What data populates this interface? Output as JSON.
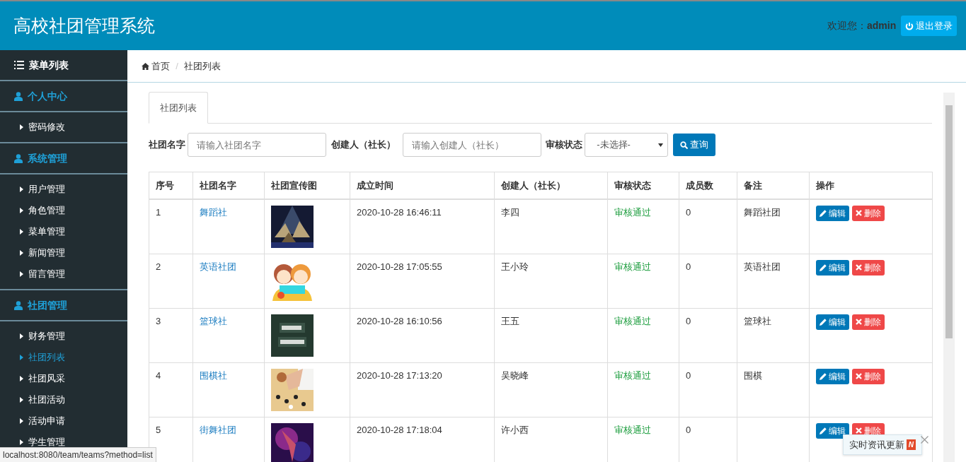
{
  "header": {
    "title": "高校社团管理系统",
    "welcome": "欢迎您：",
    "user": "admin",
    "logout": "退出登录"
  },
  "sidebar": {
    "title": "菜单列表",
    "groups": [
      {
        "label": "个人中心",
        "items": [
          {
            "label": "密码修改",
            "selected": false
          }
        ]
      },
      {
        "label": "系统管理",
        "items": [
          {
            "label": "用户管理",
            "selected": false
          },
          {
            "label": "角色管理",
            "selected": false
          },
          {
            "label": "菜单管理",
            "selected": false
          },
          {
            "label": "新闻管理",
            "selected": false
          },
          {
            "label": "留言管理",
            "selected": false
          }
        ]
      },
      {
        "label": "社团管理",
        "items": [
          {
            "label": "财务管理",
            "selected": false
          },
          {
            "label": "社团列表",
            "selected": true
          },
          {
            "label": "社团风采",
            "selected": false
          },
          {
            "label": "社团活动",
            "selected": false
          },
          {
            "label": "活动申请",
            "selected": false
          },
          {
            "label": "学生管理",
            "selected": false
          }
        ]
      }
    ]
  },
  "breadcrumb": [
    "首页",
    "社团列表"
  ],
  "breadcrumb_separator": "/",
  "tabs": [
    {
      "label": "社团列表",
      "selected": true
    }
  ],
  "filters": {
    "name_label": "社团名字",
    "name_placeholder": "请输入社团名字",
    "creator_label": "创建人（社长）",
    "creator_placeholder": "请输入创建人（社长）",
    "status_label": "审核状态",
    "status_value": "-未选择-",
    "search": "查询"
  },
  "table": {
    "columns": [
      "序号",
      "社团名字",
      "社团宣传图",
      "成立时间",
      "创建人（社长）",
      "审核状态",
      "成员数",
      "备注",
      "操作"
    ],
    "rows": [
      {
        "no": "1",
        "name": "舞蹈社",
        "time": "2020-10-28 16:46:11",
        "creator": "李四",
        "status": "审核通过",
        "members": "0",
        "note": "舞蹈社团",
        "edit": "编辑",
        "delete": "删除"
      },
      {
        "no": "2",
        "name": "英语社团",
        "time": "2020-10-28 17:05:55",
        "creator": "王小玲",
        "status": "审核通过",
        "members": "0",
        "note": "英语社团",
        "edit": "编辑",
        "delete": "删除"
      },
      {
        "no": "3",
        "name": "篮球社",
        "time": "2020-10-28 16:10:56",
        "creator": "王五",
        "status": "审核通过",
        "members": "0",
        "note": "篮球社",
        "edit": "编辑",
        "delete": "删除"
      },
      {
        "no": "4",
        "name": "围棋社",
        "time": "2020-10-28 17:13:20",
        "creator": "吴晓峰",
        "status": "审核通过",
        "members": "0",
        "note": "围棋",
        "edit": "编辑",
        "delete": "删除"
      },
      {
        "no": "5",
        "name": "街舞社团",
        "time": "2020-10-28 17:18:04",
        "creator": "许小西",
        "status": "审核通过",
        "members": "0",
        "edit": "编辑",
        "delete": "删除"
      }
    ]
  },
  "news_popup": {
    "text": "实时资讯更新",
    "badge": "N"
  },
  "status_bar": "localhost:8080/team/teams?method=list"
}
